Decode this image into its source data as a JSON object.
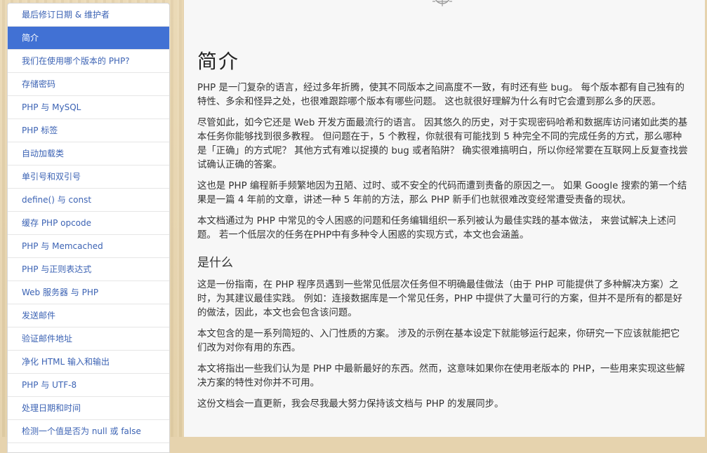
{
  "sidebar": {
    "items": [
      {
        "label": "最后修订日期 & 维护者",
        "active": false
      },
      {
        "label": "简介",
        "active": true
      },
      {
        "label": "我们在使用哪个版本的 PHP?",
        "active": false
      },
      {
        "label": "存储密码",
        "active": false
      },
      {
        "label": "PHP 与 MySQL",
        "active": false
      },
      {
        "label": "PHP 标签",
        "active": false
      },
      {
        "label": "自动加载类",
        "active": false
      },
      {
        "label": "单引号和双引号",
        "active": false
      },
      {
        "label": "define() 与 const",
        "active": false
      },
      {
        "label": "缓存 PHP opcode",
        "active": false
      },
      {
        "label": "PHP 与 Memcached",
        "active": false
      },
      {
        "label": "PHP 与正则表达式",
        "active": false
      },
      {
        "label": "Web 服务器 与 PHP",
        "active": false
      },
      {
        "label": "发送邮件",
        "active": false
      },
      {
        "label": "验证邮件地址",
        "active": false
      },
      {
        "label": "净化 HTML 输入和输出",
        "active": false
      },
      {
        "label": "PHP 与 UTF-8",
        "active": false
      },
      {
        "label": "处理日期和时间",
        "active": false
      },
      {
        "label": "检测一个值是否为 null 或 false",
        "active": false
      }
    ]
  },
  "main": {
    "title": "简介",
    "intro_paragraphs": [
      "PHP 是一门复杂的语言，经过多年折腾，使其不同版本之间高度不一致，有时还有些 bug。 每个版本都有自己独有的特性、多余和怪异之处，也很难跟踪哪个版本有哪些问题。 这也就很好理解为什么有时它会遭到那么多的厌恶。",
      "尽管如此，如今它还是 Web 开发方面最流行的语言。 因其悠久的历史，对于实现密码哈希和数据库访问诸如此类的基本任务你能够找到很多教程。 但问题在于，5 个教程，你就很有可能找到 5 种完全不同的完成任务的方式，那么哪种是「正确」的方式呢？ 其他方式有难以捉摸的 bug 或者陷阱？ 确实很难搞明白，所以你经常要在互联网上反复查找尝试确认正确的答案。",
      "这也是 PHP 编程新手频繁地因为丑陋、过时、或不安全的代码而遭到责备的原因之一。 如果 Google 搜索的第一个结果是一篇 4 年前的文章，讲述一种 5 年前的方法，那么 PHP 新手们也就很难改变经常遭受责备的现状。",
      "本文档通过为 PHP 中常见的令人困惑的问题和任务编辑组织一系列被认为最佳实践的基本做法， 来尝试解决上述问题。 若一个低层次的任务在PHP中有多种令人困惑的实现方式，本文也会涵盖。"
    ],
    "section_title": "是什么",
    "section_paragraphs": [
      "这是一份指南，在 PHP 程序员遇到一些常见低层次任务但不明确最佳做法（由于 PHP 可能提供了多种解决方案）之时，为其建议最佳实践。 例如：连接数据库是一个常见任务，PHP 中提供了大量可行的方案，但并不是所有的都是好的做法，因此，本文也会包含该问题。",
      "本文包含的是一系列简短的、入门性质的方案。 涉及的示例在基本设定下就能够运行起来，你研究一下应该就能把它们改为对你有用的东西。",
      "本文将指出一些我们认为是 PHP 中最新最好的东西。然而，这意味如果你在使用老版本的 PHP，一些用来实现这些解决方案的特性对你并不可用。",
      "这份文档会一直更新，我会尽我最大努力保持该文档与 PHP 的发展同步。"
    ]
  },
  "theme": {
    "accent": "#4171d4",
    "link": "#3c63b4",
    "background_wood": "#e6d3ae"
  },
  "icons": {
    "header_emblem": "ship-wheel-icon"
  }
}
